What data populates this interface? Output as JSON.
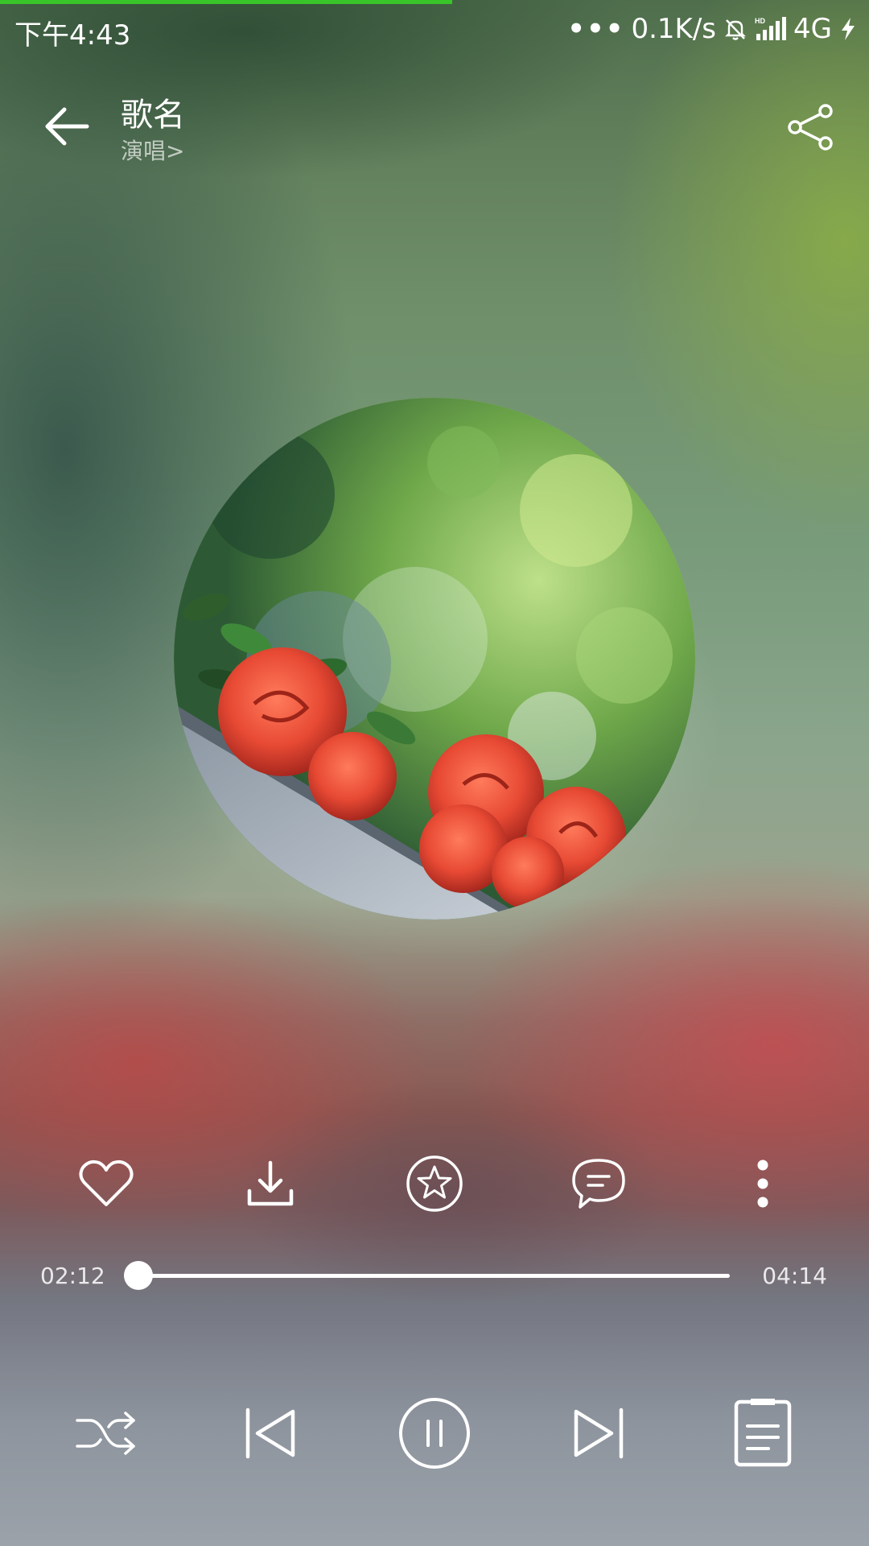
{
  "status_bar": {
    "time": "下午4:43",
    "network_speed": "0.1K/s",
    "network_type": "4G",
    "icons": [
      "more-dots-icon",
      "mute-icon",
      "signal-icon",
      "charging-icon"
    ]
  },
  "header": {
    "title": "歌名",
    "artist": "演唱>",
    "back_icon": "back-arrow-icon",
    "share_icon": "share-icon"
  },
  "album": {
    "art_icon": "album-art-roses"
  },
  "actions": [
    {
      "name": "favorite",
      "icon": "heart-icon"
    },
    {
      "name": "download",
      "icon": "download-icon"
    },
    {
      "name": "rate",
      "icon": "star-icon"
    },
    {
      "name": "comments",
      "icon": "comment-icon"
    },
    {
      "name": "more",
      "icon": "more-vertical-icon"
    }
  ],
  "progress": {
    "current": "02:12",
    "total": "04:14",
    "fraction": 0.0
  },
  "controls": [
    {
      "name": "shuffle",
      "icon": "shuffle-icon"
    },
    {
      "name": "previous",
      "icon": "previous-icon"
    },
    {
      "name": "pause",
      "icon": "pause-icon"
    },
    {
      "name": "next",
      "icon": "next-icon"
    },
    {
      "name": "playlist",
      "icon": "playlist-icon"
    }
  ],
  "colors": {
    "load_strip": "#39c42a",
    "foreground": "#ffffff"
  },
  "top_load_fraction": 0.52
}
